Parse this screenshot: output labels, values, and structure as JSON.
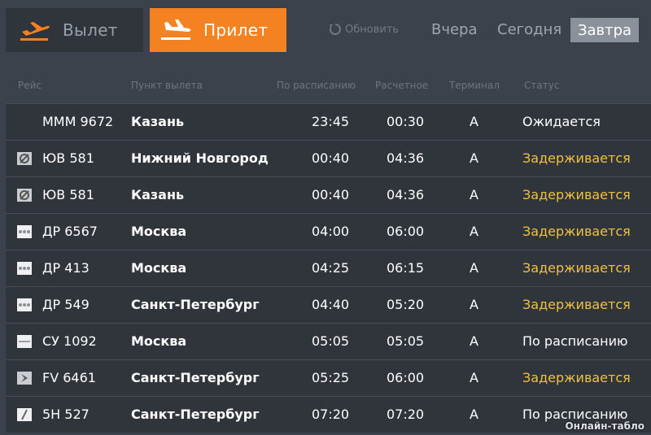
{
  "tabs": {
    "departure_label": "Вылет",
    "arrival_label": "Прилет"
  },
  "refresh_label": "Обновить",
  "days": {
    "yesterday": "Вчера",
    "today": "Сегодня",
    "tomorrow": "Завтра"
  },
  "columns": {
    "flight": "Рейс",
    "origin": "Пункт вылета",
    "scheduled": "По расписанию",
    "estimated": "Расчетное",
    "terminal": "Терминал",
    "status": "Статус"
  },
  "flights": [
    {
      "flight": "МММ 9672",
      "city": "Казань",
      "scheduled": "23:45",
      "estimated": "00:30",
      "terminal": "A",
      "status": "Ожидается",
      "delayed": false,
      "logo": "none"
    },
    {
      "flight": "ЮВ 581",
      "city": "Нижний Новгород",
      "scheduled": "00:40",
      "estimated": "04:36",
      "terminal": "A",
      "status": "Задерживается",
      "delayed": true,
      "logo": "airline-logo-icon"
    },
    {
      "flight": "ЮВ 581",
      "city": "Казань",
      "scheduled": "00:40",
      "estimated": "04:36",
      "terminal": "A",
      "status": "Задерживается",
      "delayed": true,
      "logo": "airline-logo-icon"
    },
    {
      "flight": "ДР 6567",
      "city": "Москва",
      "scheduled": "04:00",
      "estimated": "06:00",
      "terminal": "A",
      "status": "Задерживается",
      "delayed": true,
      "logo": "airline-logo-icon"
    },
    {
      "flight": "ДР 413",
      "city": "Москва",
      "scheduled": "04:25",
      "estimated": "06:15",
      "terminal": "A",
      "status": "Задерживается",
      "delayed": true,
      "logo": "airline-logo-icon"
    },
    {
      "flight": "ДР 549",
      "city": "Санкт-Петербург",
      "scheduled": "04:40",
      "estimated": "05:20",
      "terminal": "A",
      "status": "Задерживается",
      "delayed": true,
      "logo": "airline-logo-icon"
    },
    {
      "flight": "СУ 1092",
      "city": "Москва",
      "scheduled": "05:05",
      "estimated": "05:05",
      "terminal": "A",
      "status": "По расписанию",
      "delayed": false,
      "logo": "airline-logo-icon"
    },
    {
      "flight": "FV 6461",
      "city": "Санкт-Петербург",
      "scheduled": "05:25",
      "estimated": "06:00",
      "terminal": "A",
      "status": "Задерживается",
      "delayed": true,
      "logo": "airline-logo-icon"
    },
    {
      "flight": "5Н 527",
      "city": "Санкт-Петербург",
      "scheduled": "07:20",
      "estimated": "07:20",
      "terminal": "A",
      "status": "По расписанию",
      "delayed": false,
      "logo": "airline-logo-icon"
    }
  ],
  "watermark": "Онлайн-табло",
  "colors": {
    "accent": "#f58220",
    "delayed_status": "#f0c040",
    "background": "#3c424b",
    "row": "#30353c"
  }
}
